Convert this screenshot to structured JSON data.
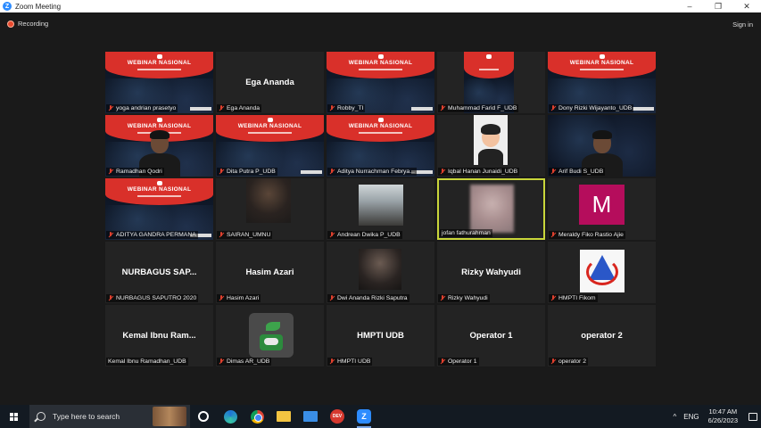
{
  "window": {
    "title": "Zoom Meeting",
    "logo_letter": "Z",
    "minimize": "–",
    "maximize": "❐",
    "close": "✕"
  },
  "meeting": {
    "recording_label": "Recording",
    "signin_label": "Sign in"
  },
  "slide": {
    "title": "WEBINAR NASIONAL"
  },
  "participants": [
    {
      "label": "yoga andrian prasetyo"
    },
    {
      "label": "Ega Ananda",
      "display_name": "Ega Ananda"
    },
    {
      "label": "Robby_TI"
    },
    {
      "label": "Muhammad Farid F_UDB"
    },
    {
      "label": "Dony Rizki Wijayanto_UDB"
    },
    {
      "label": "Ramadhan Qodri"
    },
    {
      "label": "Dita Putra P_UDB"
    },
    {
      "label": "Aditya Nurrachman Febrya..."
    },
    {
      "label": "Iqbal Hanan Junaidi_UDB"
    },
    {
      "label": "Arif Budi S_UDB"
    },
    {
      "label": "ADITYA GANDRA PERMANA"
    },
    {
      "label": "SAIRAN_UMNU"
    },
    {
      "label": "Andrean Dwika P_UDB"
    },
    {
      "label": "jofan fathurahman"
    },
    {
      "label": "Meraldy Fiko Rastio Ajie",
      "avatar_letter": "M"
    },
    {
      "label": "NURBAGUS SAPUTRO 2020",
      "display_name": "NURBAGUS SAP..."
    },
    {
      "label": "Hasim Azari",
      "display_name": "Hasim Azari"
    },
    {
      "label": "Dwi Ananda Rizki Saputra"
    },
    {
      "label": "Rizky Wahyudi",
      "display_name": "Rizky Wahyudi"
    },
    {
      "label": "HMPTI Fikom"
    },
    {
      "label": "Kemal Ibnu Ramadhan_UDB",
      "display_name": "Kemal Ibnu Ram..."
    },
    {
      "label": "Dimas AR_UDB"
    },
    {
      "label": "HMPTI UDB",
      "display_name": "HMPTI UDB"
    },
    {
      "label": "Operator 1",
      "display_name": "Operator 1"
    },
    {
      "label": "operator 2",
      "display_name": "operator 2"
    }
  ],
  "taskbar": {
    "search_placeholder": "Type here to search",
    "dev_icon_text": "DEV",
    "zoom_icon_text": "Z",
    "tray": {
      "caret": "^",
      "language": "ENG",
      "time": "10:47 AM",
      "date": "6/26/2023"
    }
  },
  "icons": [
    "zoom-logo-icon",
    "recording-dot-icon",
    "mic-muted-icon",
    "windows-start-icon",
    "search-icon",
    "task-view-icon",
    "edge-icon",
    "chrome-icon",
    "file-explorer-icon",
    "mail-icon",
    "dev-app-icon",
    "zoom-taskbar-icon",
    "notification-icon"
  ]
}
